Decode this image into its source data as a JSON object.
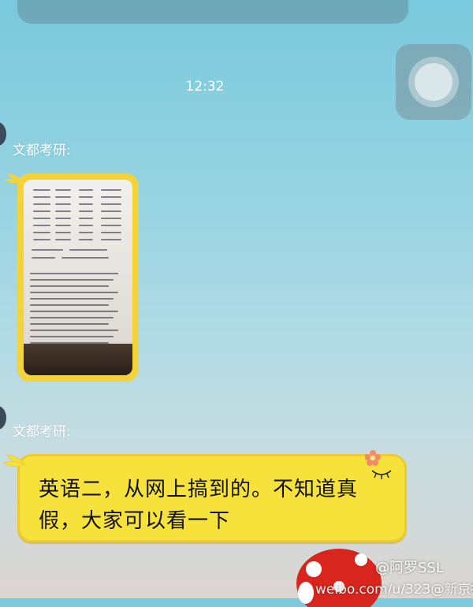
{
  "top_bubble": {
    "text": ""
  },
  "time_label": "12:32",
  "messages": [
    {
      "sender": "文都考研:",
      "type": "image"
    },
    {
      "sender": "文都考研:",
      "type": "text",
      "text": "英语二，从网上搞到的。不知道真假，大家可以看一下"
    }
  ],
  "watermark": {
    "handle": "@阿罗SSL",
    "url": "weibo.com/u/323",
    "source": "@新京报"
  },
  "colors": {
    "bubble": "#f7e23b",
    "bubble_border": "#efc92e",
    "background_top": "#79c9dc",
    "background_bottom": "#dcd6d2"
  },
  "icons": {
    "float_button": "assistive-touch-icon",
    "sprout": "sprout-icon",
    "flower": "flower-icon"
  }
}
